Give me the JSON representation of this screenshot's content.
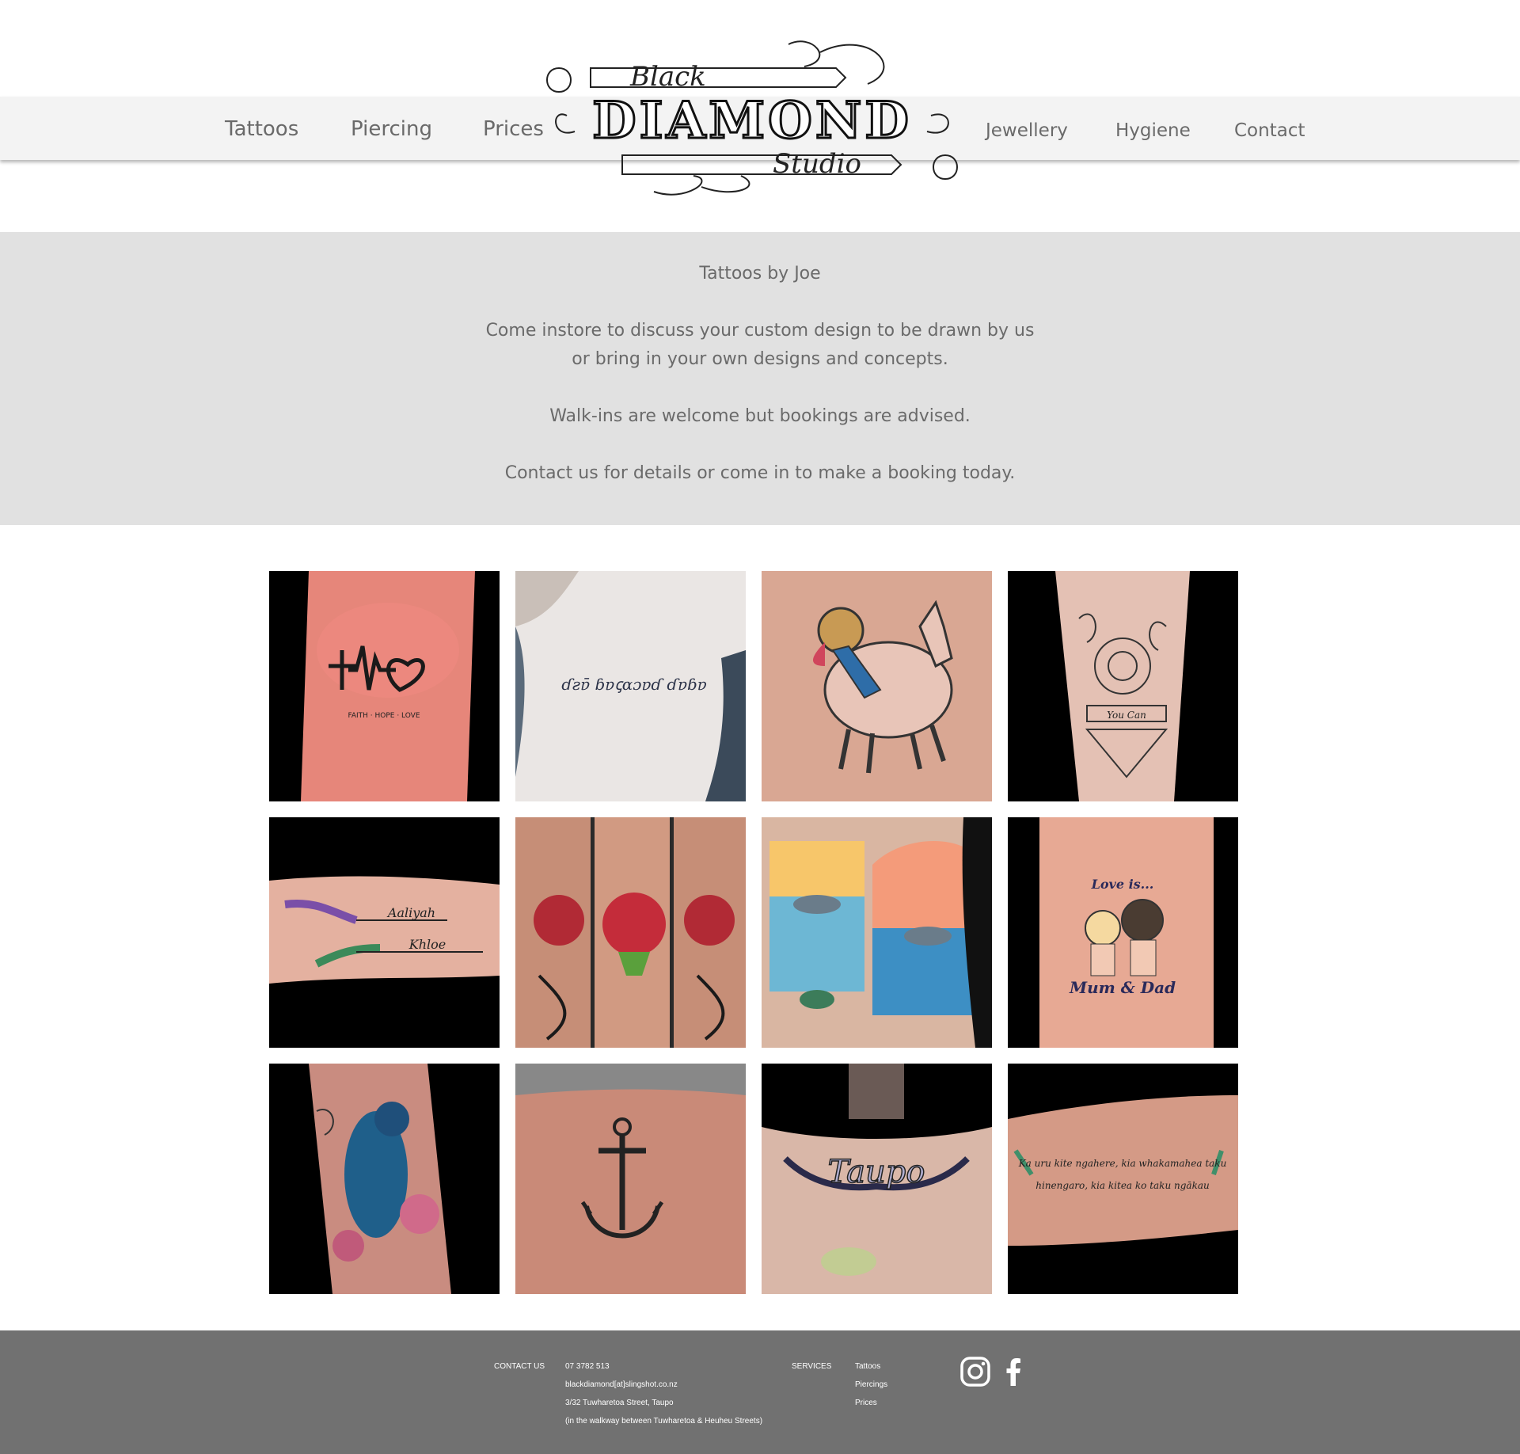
{
  "nav": {
    "left": [
      "Tattoos",
      "Piercing",
      "Prices"
    ],
    "right": [
      "Jewellery",
      "Hygiene",
      "Contact"
    ]
  },
  "logo": {
    "top_word": "Black",
    "main_word": "DIAMOND",
    "bottom_word": "Studio"
  },
  "intro": {
    "heading": "Tattoos by Joe",
    "line1": "Come instore to discuss your custom design to be drawn by us",
    "line2": "or bring in your own designs and concepts.",
    "line3": "Walk-ins are welcome but bookings are advised.",
    "line4": "Contact us for details or come in to make a booking today."
  },
  "gallery": {
    "tiles": [
      {
        "name": "faith-hope-love-wrist-tattoo",
        "text": "FAITH · HOPE · LOVE"
      },
      {
        "name": "script-ribs-tattoo",
        "text": "ɗƨɐ̄ ɓɐꞔɑɔɐɗ ɗɐɓɐ"
      },
      {
        "name": "cartoon-llama-rider-tattoo",
        "text": ""
      },
      {
        "name": "rose-mandala-you-can-tattoo",
        "text": "You Can"
      },
      {
        "name": "aaliyah-khloe-arrows-tattoo",
        "text": "Aaliyah",
        "text2": "Khloe"
      },
      {
        "name": "oni-mask-forearm-tattoo",
        "text": ""
      },
      {
        "name": "dolphin-sunset-ocean-tattoo",
        "text": ""
      },
      {
        "name": "love-is-mum-dad-tattoo",
        "text": "Love is...",
        "text2": "Mum & Dad"
      },
      {
        "name": "tui-bird-flowers-tattoo",
        "text": ""
      },
      {
        "name": "anchor-tattoo",
        "text": ""
      },
      {
        "name": "taupo-chest-tattoo",
        "text": "Taupo"
      },
      {
        "name": "maori-proverb-forearm-tattoo",
        "text": "Ka uru kite ngahere, kia whakamahea taku",
        "text2": "hinengaro, kia kitea ko taku ngākau"
      }
    ]
  },
  "footer": {
    "contact_label": "CONTACT US",
    "phone": "07 3782 513",
    "email": "blackdiamond[at]slingshot.co.nz",
    "address": "3/32 Tuwharetoa Street, Taupo",
    "address_note": "(in the walkway between Tuwharetoa & Heuheu Streets)",
    "services_label": "SERVICES",
    "services": [
      "Tattoos",
      "Piercings",
      "Prices"
    ],
    "social": [
      "instagram-icon",
      "facebook-icon"
    ]
  }
}
